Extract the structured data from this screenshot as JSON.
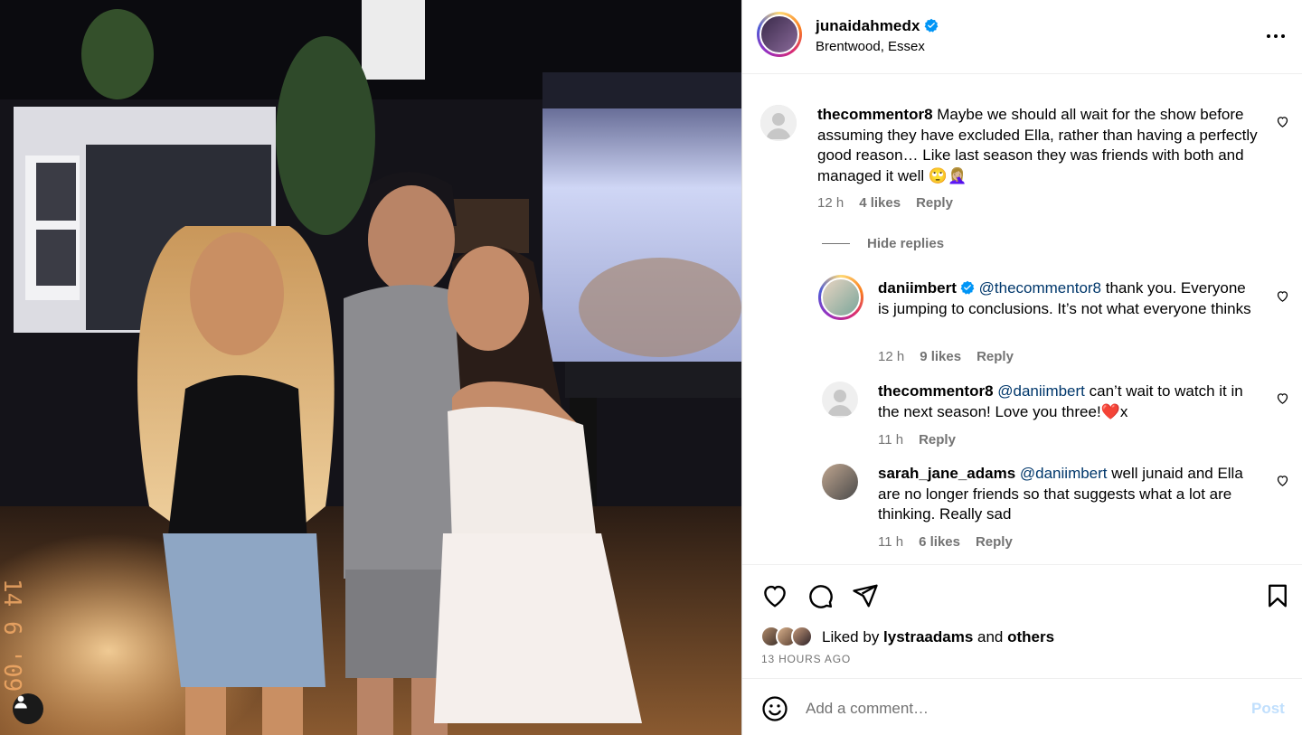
{
  "post": {
    "username": "junaidahmedx",
    "verified": true,
    "location": "Brentwood, Essex",
    "more_icon": "more-horizontal-icon"
  },
  "comments": [
    {
      "username": "thecommentor8",
      "text": "Maybe we should all wait for the show before assuming they have excluded Ella, rather than having a perfectly good reason… Like last season they was friends with both and managed it well 🙄🤦🏼‍♀️",
      "time": "12 h",
      "likes": "4 likes",
      "reply": "Reply"
    }
  ],
  "hide_replies": "Hide replies",
  "replies": [
    {
      "username": "daniimbert",
      "verified": true,
      "mention": "@thecommentor8",
      "text": " thank you. Everyone is jumping to conclusions. It’s not what everyone thinks",
      "time": "12 h",
      "likes": "9 likes",
      "reply": "Reply"
    },
    {
      "username": "thecommentor8",
      "mention": "@daniimbert",
      "text": " can’t wait to watch it in the next season! Love you three!❤️x",
      "time": "11 h",
      "likes": "",
      "reply": "Reply"
    },
    {
      "username": "sarah_jane_adams",
      "mention": "@daniimbert",
      "text": " well junaid and Ella are no longer friends so that suggests what a lot are thinking. Really sad",
      "time": "11 h",
      "likes": "6 likes",
      "reply": "Reply"
    }
  ],
  "actions": {
    "liked_by_prefix": "Liked by ",
    "liked_by_user": "lystraadams",
    "liked_by_and": " and ",
    "liked_by_others": "others",
    "time_ago": "13 HOURS AGO"
  },
  "add_comment": {
    "placeholder": "Add a comment…",
    "post_label": "Post"
  },
  "photo": {
    "date_stamp": "14 6 '09"
  },
  "colors": {
    "mention": "#00376b",
    "meta": "#737373",
    "verified": "#0095f6",
    "post_disabled": "#c0dffd"
  }
}
